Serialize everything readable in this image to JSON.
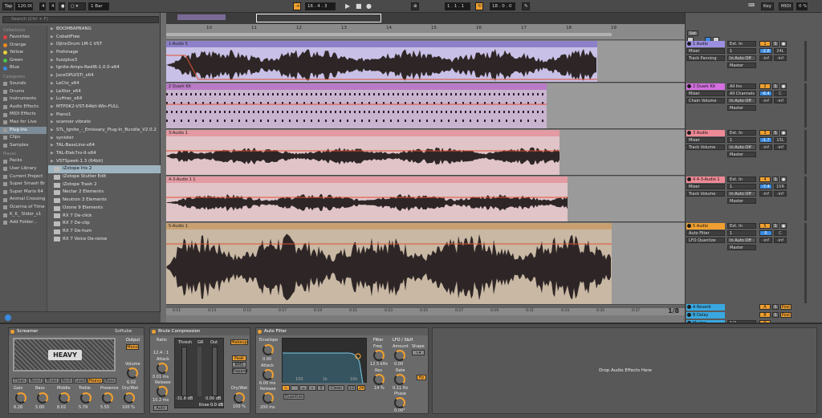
{
  "transport": {
    "tap": "Tap",
    "tempo": "120.00",
    "sig_num": "4",
    "sig_den": "4",
    "quantize": "1 Bar",
    "position": "16 . 4 . 3",
    "loop_start": "1 . 1 . 1",
    "loop_length": "18 . 0 . 0",
    "key": "Key",
    "midi": "MIDI",
    "cpu": "0 %"
  },
  "browser": {
    "search_placeholder": "Search (Ctrl + F)",
    "collections_header": "Collections",
    "collections": [
      {
        "label": "Favorites",
        "color": "#e04040"
      },
      {
        "label": "Orange",
        "color": "#f08a20"
      },
      {
        "label": "Yellow",
        "color": "#e6d23a"
      },
      {
        "label": "Green",
        "color": "#4cc24c"
      },
      {
        "label": "Blue",
        "color": "#3a8ae0"
      }
    ],
    "categories_header": "Categories",
    "categories": [
      "Sounds",
      "Drums",
      "Instruments",
      "Audio Effects",
      "MIDI Effects",
      "Max for Live",
      "Plug-ins",
      "Clips",
      "Samples"
    ],
    "selected_category": "Plug-ins",
    "places_header": "Places",
    "places": [
      "Packs",
      "User Library",
      "Current Project",
      "Super Smash Br",
      "Super Mario 64",
      "Animal Crossing",
      "Ocarina of Time",
      "K_K_ Slider_s1",
      "Add Folder..."
    ],
    "files": [
      "BOOMBAPBANG",
      "CobaltFree",
      "DJinnDrum LM-1 VST",
      "Frohmage",
      "fuzzplus3",
      "Ignite-Amps-RedIR-1.0.0-x64",
      "JuceOPLVSTi_x64",
      "LeCto_x64",
      "LeXtor_x64",
      "LuHrac_x64",
      "MTPDK2-VST-64bit-Win-FULL",
      "Piano1",
      "scanner vibrato",
      "STL_Ignite_-_Emissary_Plug-In_Bundle_V2.0.2",
      "synister",
      "TAL-BassLine-x64",
      "TAL-Elek7ro-II-x64",
      "VSTSpeek-1.3 (64bit)",
      "iZotope Iris 2",
      "iZotope Stutter Edit",
      "iZotope Trash 2",
      "Nectar 2 Elements",
      "Neutron 3 Elements",
      "Ozone 9 Elements",
      "RX 7 De-click",
      "RX 7 De-clip",
      "RX 7 De-hum",
      "RX 7 Voice De-noise"
    ],
    "selected_file": "iZotope Iris 2"
  },
  "ruler": [
    "10",
    "11",
    "12",
    "13",
    "14",
    "15",
    "16",
    "17",
    "18",
    "19"
  ],
  "timecodes": [
    "0:11",
    "0:13",
    "0:15",
    "0:17",
    "0:19",
    "0:21",
    "0:23",
    "0:25",
    "0:27",
    "0:29",
    "0:31",
    "0:33",
    "0:35",
    "0:37",
    "0:39"
  ],
  "zoom_label": "1/8",
  "set_button": "Set",
  "tracks": [
    {
      "clip": "1-Audio 5",
      "name": "1 Audio",
      "color": "#9b8fe0",
      "clipcolor": "#8d80c9",
      "input": "Ext. In",
      "sub": "1",
      "device": "Mixer",
      "param": "Track Panning",
      "monitor": "In Auto Off",
      "out": "Master",
      "num": "1",
      "vol": "-2.8",
      "pan": "24L",
      "inf1": "-inf",
      "inf2": "-inf"
    },
    {
      "clip": "2 Quark Kit",
      "name": "2 Quark Kit",
      "color": "#d46fe0",
      "clipcolor": "#b97ac6",
      "input": "All Ins",
      "sub": "All Channels",
      "device": "Mixer",
      "param": "Chain Volume",
      "monitor": "In Auto Off",
      "out": "Master",
      "num": "2",
      "vol": "-6.4",
      "pan": "C",
      "inf1": "-inf",
      "inf2": "-inf"
    },
    {
      "clip": "3-Audio 1",
      "name": "3 Audio",
      "color": "#ee8a96",
      "clipcolor": "#e39aa2",
      "input": "Ext. In",
      "sub": "1",
      "device": "Mixer",
      "param": "Track Volume",
      "monitor": "In Auto Off",
      "out": "Master",
      "num": "3",
      "vol": "-1.7",
      "pan": "15L",
      "inf1": "-inf",
      "inf2": "-inf"
    },
    {
      "clip": "4-3-Audio 1 1",
      "name": "4 4-3-Audio 1",
      "color": "#ee8a96",
      "clipcolor": "#e39aa2",
      "input": "Ext. In",
      "sub": "1",
      "device": "Mixer",
      "param": "Track Volume",
      "monitor": "In Auto Off",
      "out": "Master",
      "num": "4",
      "vol": "-7.4",
      "pan": "15R",
      "inf1": "-inf",
      "inf2": "-inf"
    },
    {
      "clip": "5-Audio 1",
      "name": "5 Audio",
      "color": "#f0a030",
      "clipcolor": "#c8a070",
      "input": "Ext. In",
      "sub": "1",
      "device": "Auto Filter",
      "param": "LFO Quantize",
      "monitor": "In Auto Off",
      "out": "Master",
      "num": "5",
      "vol": "0",
      "pan": "C",
      "inf1": "-inf",
      "inf2": "-inf"
    }
  ],
  "returns": [
    {
      "name": "A Reverb",
      "letter": "A",
      "post": "Post"
    },
    {
      "name": "B Delay",
      "letter": "B",
      "post": "Post"
    }
  ],
  "master": {
    "name": "Master",
    "out": "1/2",
    "btn": "0"
  },
  "devices": {
    "screamer": {
      "title": "Screamer",
      "brand": "Softube",
      "output_label": "Output",
      "output_mode": "Mono",
      "logo": "HEAVY",
      "modes": [
        "Clean",
        "Boost",
        "Blues",
        "Rock",
        "Lead",
        "Heavy",
        "Bass"
      ],
      "active_mode": "Heavy",
      "volume_label": "Volume",
      "volume_value": "6.02",
      "knobs": [
        {
          "label": "Gain",
          "value": "6.26"
        },
        {
          "label": "Bass",
          "value": "5.00"
        },
        {
          "label": "Middle",
          "value": "8.02"
        },
        {
          "label": "Treble",
          "value": "5.79"
        },
        {
          "label": "Presence",
          "value": "5.55"
        },
        {
          "label": "Dry/Wet",
          "value": "100 %"
        }
      ]
    },
    "compressor": {
      "title": "Brute Compression",
      "ratio_label": "Ratio",
      "ratio_value": "12.4 : 1",
      "attack_label": "Attack",
      "attack_value": "0.01 ms",
      "release_label": "Release",
      "release_value": "10.2 ms",
      "auto_label": "Auto",
      "thresh_label": "Thresh",
      "gr_label": "GR",
      "out_label": "Out",
      "thresh_value": "-31.8 dB",
      "out_value": "0.00 dB",
      "knee_label": "Knee",
      "knee_value": "0.0 dB",
      "makeup": "Makeup",
      "peak": "Peak",
      "rms": "RMS",
      "expand": "Expand",
      "drywet_label": "Dry/Wet",
      "drywet_value": "100 %"
    },
    "autofilter": {
      "title": "Auto Filter",
      "envelope_label": "Envelope",
      "env_value": "0.00",
      "attack_label": "Attack",
      "attack_value": "6.00 ms",
      "release_label": "Release",
      "release_value": "200 ms",
      "filter_label": "Filter",
      "freq_label": "Freq",
      "freq_value": "12.5 kHz",
      "res_label": "Res",
      "res_value": "14 %",
      "graph_x1": "100",
      "graph_x2": "1k",
      "graph_x3": "10k",
      "lfo_label": "LFO / S&H",
      "amount_label": "Amount",
      "amount_value": "0.00",
      "shape_label": "Shape",
      "rate_label": "Rate",
      "rate_value": "0.11 Hz",
      "phase_label": "Phase",
      "phase_value": "0.00°",
      "hz": "Hz",
      "quantize": "Quantize",
      "clean": "Clean",
      "v12": "12",
      "v24": "24"
    },
    "drop_hint": "Drop Audio Effects Here"
  }
}
